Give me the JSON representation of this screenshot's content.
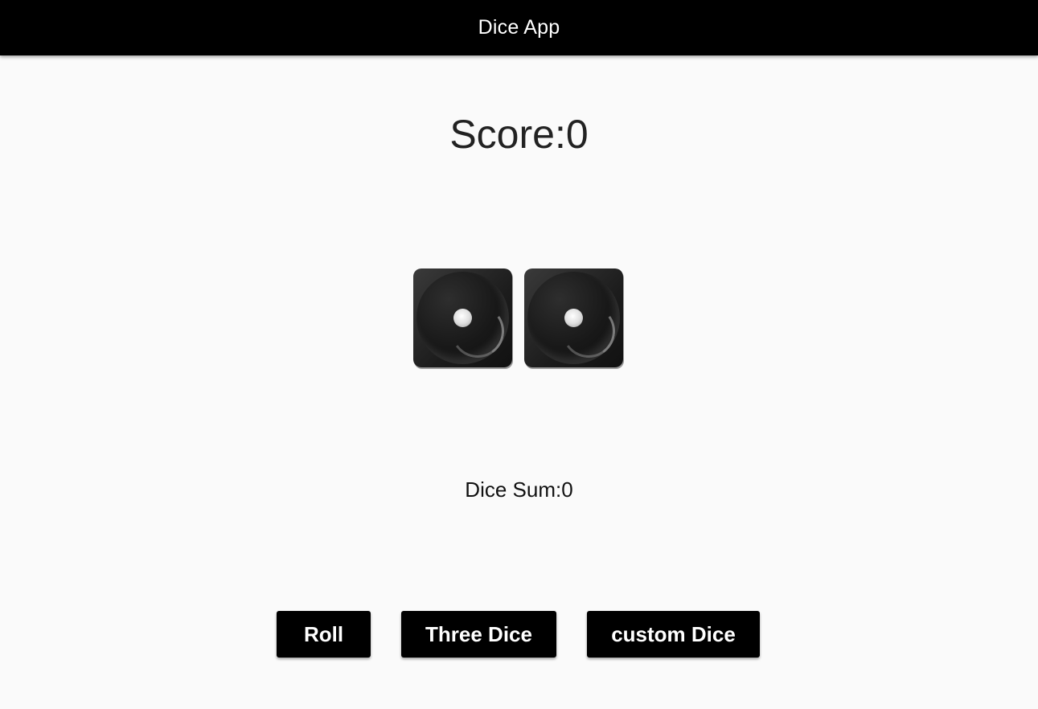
{
  "app_bar": {
    "title": "Dice App"
  },
  "score": {
    "text": "Score:0"
  },
  "dice": [
    {
      "value": 1,
      "icon": "die-one-icon"
    },
    {
      "value": 1,
      "icon": "die-one-icon"
    }
  ],
  "dice_sum": {
    "text": "Dice Sum:0"
  },
  "buttons": {
    "roll": "Roll",
    "three_dice": "Three Dice",
    "custom_dice": "custom Dice"
  },
  "colors": {
    "app_bar": "#000000",
    "background": "#fafafa",
    "button": "#000000",
    "button_text": "#ffffff"
  }
}
